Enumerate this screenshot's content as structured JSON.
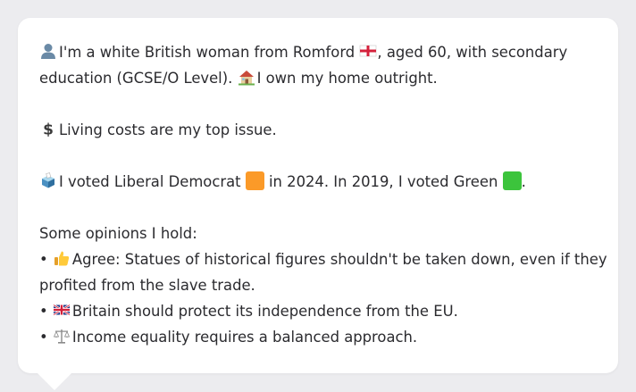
{
  "profile": {
    "line1a": "I'm a white British woman from Romford",
    "line1b": ", aged 60, with secondary",
    "line2a": "education (GCSE/O Level).",
    "line2b": "I own my home outright."
  },
  "issue": {
    "text": "Living costs are my top issue."
  },
  "voting": {
    "part1": "I voted Liberal Democrat",
    "part2": "in 2024. In 2019, I voted Green",
    "part3": "."
  },
  "opinions": {
    "heading": "Some opinions I hold:",
    "bullet": "•",
    "item1_line1": "Agree: Statues of historical figures shouldn't be taken down, even if they",
    "item1_line2": "profited from the slave trade.",
    "item2": "Britain should protect its independence from the EU.",
    "item3": "Income equality requires a balanced approach."
  },
  "icons": {
    "person": "person-icon",
    "england_flag": "england-flag-icon",
    "house": "house-icon",
    "dollar": "dollar-icon",
    "ballot_box": "ballot-box-icon",
    "libdem_square": "orange-square-icon",
    "green_square": "green-square-icon",
    "thumbs_up": "thumbs-up-icon",
    "uk_flag": "uk-flag-icon",
    "scales": "balance-scale-icon"
  },
  "colors": {
    "libdem": "#fb9a28",
    "green": "#3cc43c",
    "text": "#2b2b2f",
    "card": "#ffffff",
    "background": "#ececef"
  }
}
